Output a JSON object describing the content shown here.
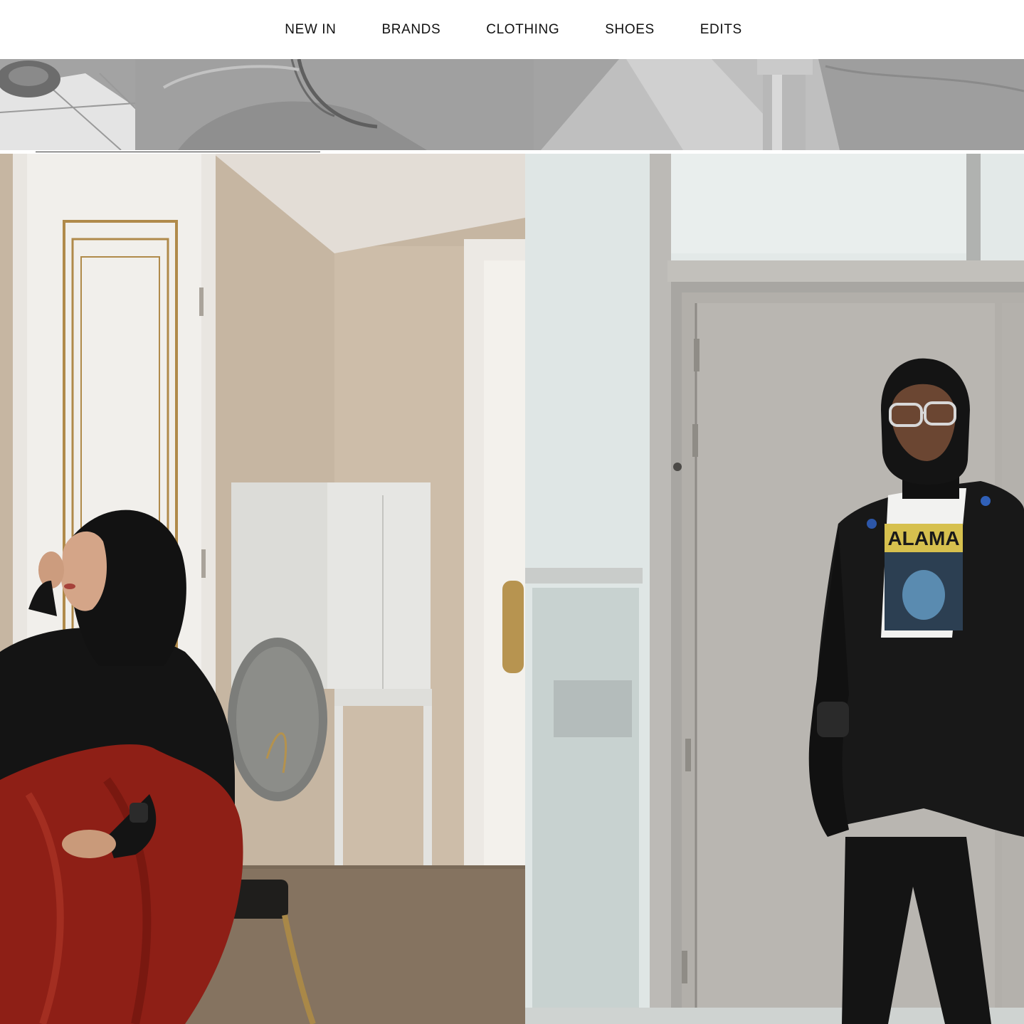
{
  "nav": {
    "items": [
      {
        "label": "NEW IN"
      },
      {
        "label": "BRANDS"
      },
      {
        "label": "CLOTHING"
      },
      {
        "label": "SHOES"
      },
      {
        "label": "EDITS"
      }
    ]
  },
  "colors": {
    "background": "#ffffff",
    "nav_text": "#111111",
    "skirt_red": "#8e1f16",
    "hijab_black": "#121212",
    "wallpaper": "#c8b8a5",
    "door_grey": "#b5b2ad"
  },
  "images": {
    "hero_strip": "grayscale-photo-icon",
    "left_panel": "woman-seated-interior-photo-icon",
    "right_panel": "woman-standing-door-photo-icon"
  },
  "tshirt_print": "ALAMA"
}
